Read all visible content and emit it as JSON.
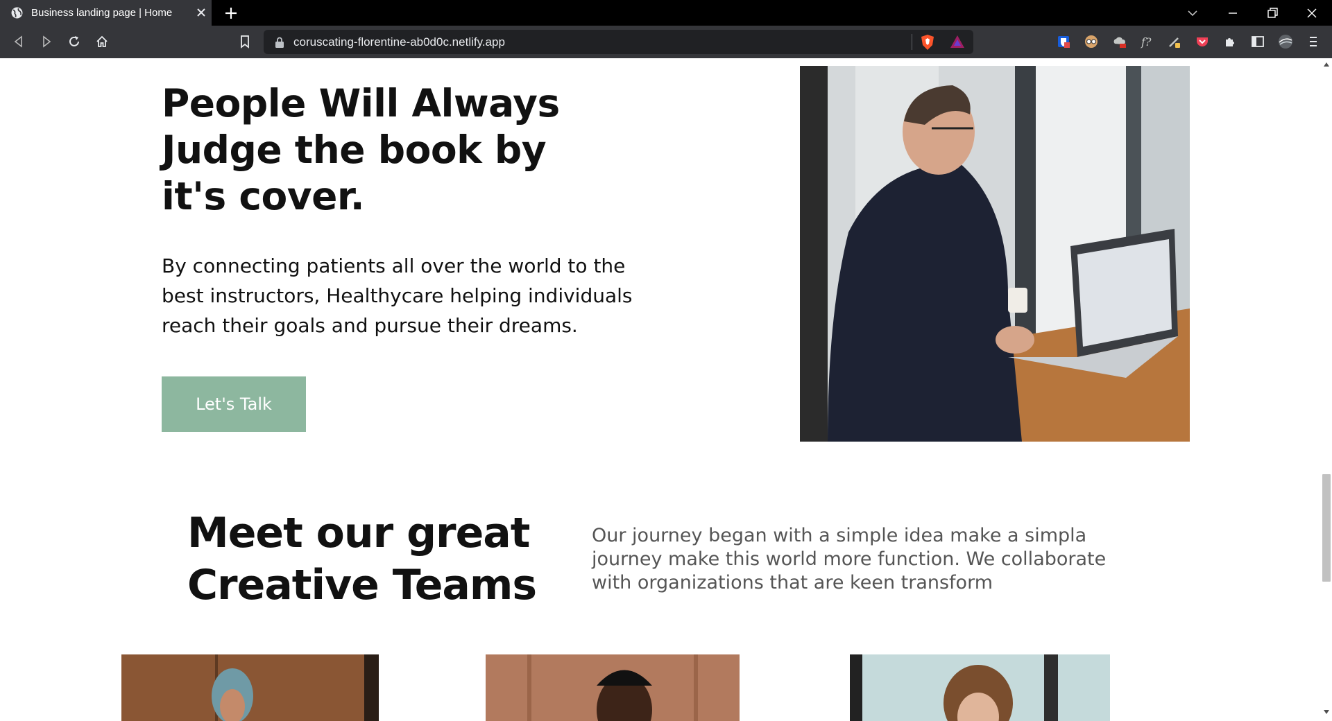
{
  "browser": {
    "tab_title": "Business landing page | Home",
    "url": "coruscating-florentine-ab0d0c.netlify.app"
  },
  "hero": {
    "title": "People Will Always Judge the book by it's cover.",
    "text": "By connecting patients all over the world to the best instructors, Healthycare helping individuals reach their goals and pursue their dreams.",
    "cta_label": "Let's Talk"
  },
  "team": {
    "title": "Meet our great Creative Teams",
    "text": "Our journey began with a simple idea make a simpla journey make this world more function. We collaborate with organizations that are keen transform"
  },
  "colors": {
    "accent": "#8db79f",
    "chrome_dark": "#35363a"
  }
}
